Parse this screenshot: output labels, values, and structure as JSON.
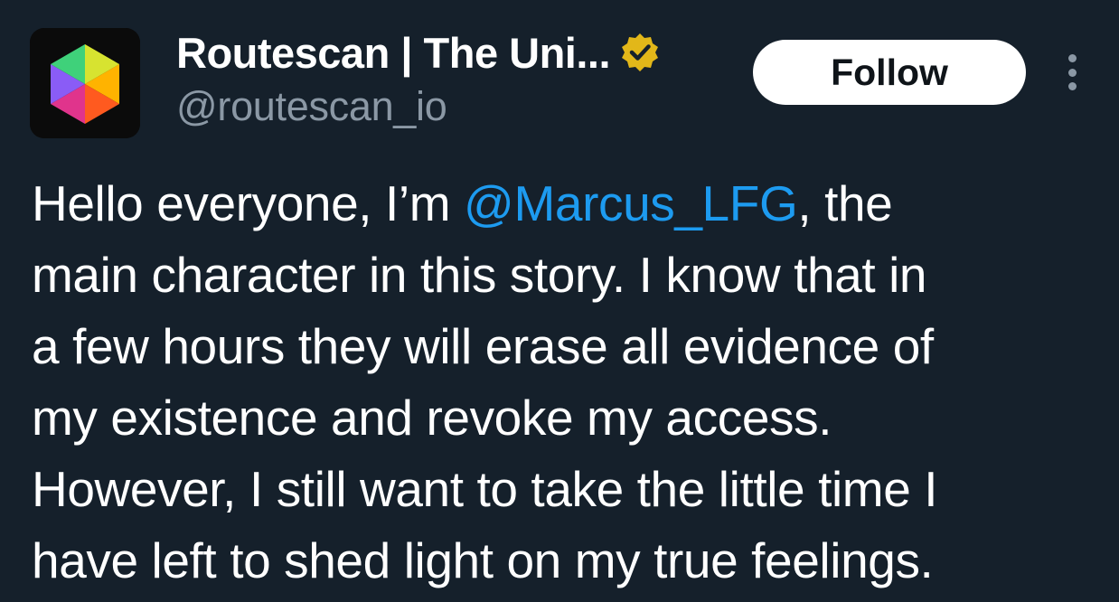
{
  "author": {
    "display_name": "Routescan | The Uni...",
    "handle": "@routescan_io",
    "verified_badge_icon": "verified-checkmark-badge-icon",
    "avatar_icon": "routescan-hexagon-logo-icon"
  },
  "actions": {
    "follow_label": "Follow",
    "more_icon": "more-options-vertical-dots-icon"
  },
  "tweet": {
    "line1_before": "Hello everyone, I’m ",
    "mention": "@Marcus_LFG",
    "line1_after": ", the",
    "line2": "main character in this story. I know that in",
    "line3": "a few hours they will erase all evidence of",
    "line4": "my existence and revoke my access.",
    "line5": "However, I still want to take the little time I",
    "line6": "have left to shed light on my true feelings."
  },
  "colors": {
    "background": "#15202b",
    "text": "#ffffff",
    "secondary_text": "#8b98a5",
    "link": "#1d9bf0",
    "badge": "#e2b719"
  }
}
